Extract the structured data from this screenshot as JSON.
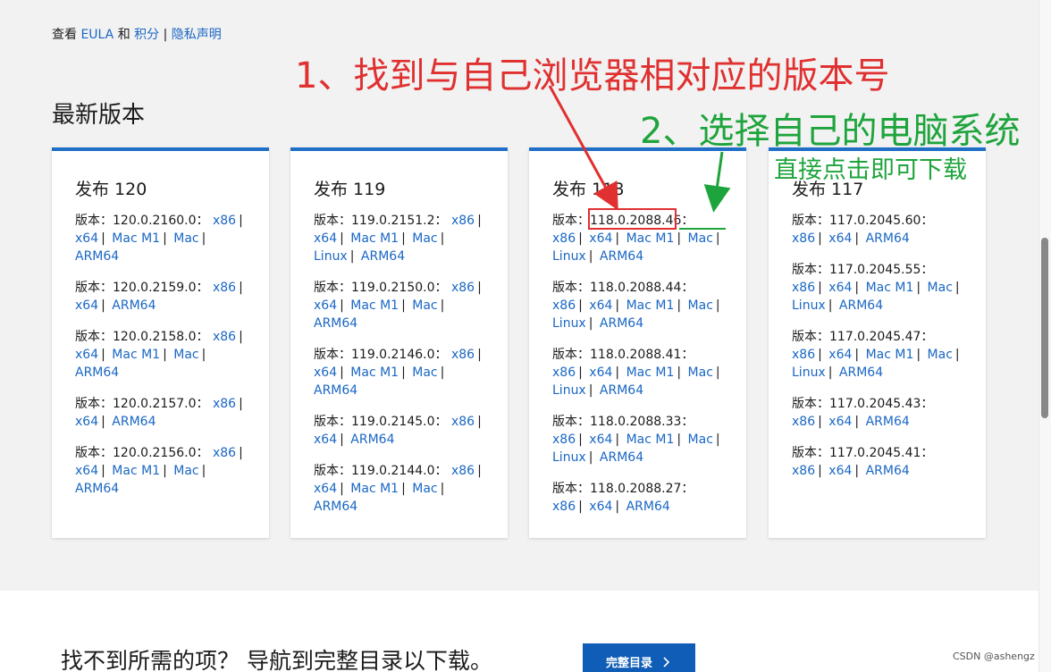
{
  "top_links": {
    "prefix": "查看",
    "eula": "EULA",
    "and": "和",
    "points": "积分",
    "sep": "|",
    "privacy": "隐私声明"
  },
  "section_title": "最新版本",
  "version_prefix": "版本：",
  "separator": "|",
  "cards": [
    {
      "title": "发布 120",
      "versions": [
        {
          "number": "120.0.2160.0：",
          "links": [
            "x86",
            "x64",
            "Mac M1",
            "Mac",
            "ARM64"
          ]
        },
        {
          "number": "120.0.2159.0：",
          "links": [
            "x86",
            "x64",
            "ARM64"
          ]
        },
        {
          "number": "120.0.2158.0：",
          "links": [
            "x86",
            "x64",
            "Mac M1",
            "Mac",
            "ARM64"
          ]
        },
        {
          "number": "120.0.2157.0：",
          "links": [
            "x86",
            "x64",
            "ARM64"
          ]
        },
        {
          "number": "120.0.2156.0：",
          "links": [
            "x86",
            "x64",
            "Mac M1",
            "Mac",
            "ARM64"
          ]
        }
      ]
    },
    {
      "title": "发布 119",
      "versions": [
        {
          "number": "119.0.2151.2：",
          "links": [
            "x86",
            "x64",
            "Mac M1",
            "Mac",
            "Linux",
            "ARM64"
          ]
        },
        {
          "number": "119.0.2150.0：",
          "links": [
            "x86",
            "x64",
            "Mac M1",
            "Mac",
            "ARM64"
          ]
        },
        {
          "number": "119.0.2146.0：",
          "links": [
            "x86",
            "x64",
            "Mac M1",
            "Mac",
            "ARM64"
          ]
        },
        {
          "number": "119.0.2145.0：",
          "links": [
            "x86",
            "x64",
            "ARM64"
          ]
        },
        {
          "number": "119.0.2144.0：",
          "links": [
            "x86",
            "x64",
            "Mac M1",
            "Mac",
            "ARM64"
          ]
        }
      ]
    },
    {
      "title": "发布 118",
      "versions": [
        {
          "number": "118.0.2088.46：",
          "links": [
            "x86",
            "x64",
            "Mac M1",
            "Mac",
            "Linux",
            "ARM64"
          ]
        },
        {
          "number": "118.0.2088.44：",
          "links": [
            "x86",
            "x64",
            "Mac M1",
            "Mac",
            "Linux",
            "ARM64"
          ]
        },
        {
          "number": "118.0.2088.41：",
          "links": [
            "x86",
            "x64",
            "Mac M1",
            "Mac",
            "Linux",
            "ARM64"
          ]
        },
        {
          "number": "118.0.2088.33：",
          "links": [
            "x86",
            "x64",
            "Mac M1",
            "Mac",
            "Linux",
            "ARM64"
          ]
        },
        {
          "number": "118.0.2088.27：",
          "links": [
            "x86",
            "x64",
            "ARM64"
          ]
        }
      ]
    },
    {
      "title": "发布 117",
      "versions": [
        {
          "number": "117.0.2045.60：",
          "links": [
            "x86",
            "x64",
            "ARM64"
          ]
        },
        {
          "number": "117.0.2045.55：",
          "links": [
            "x86",
            "x64",
            "Mac M1",
            "Mac",
            "Linux",
            "ARM64"
          ]
        },
        {
          "number": "117.0.2045.47：",
          "links": [
            "x86",
            "x64",
            "Mac M1",
            "Mac",
            "Linux",
            "ARM64"
          ]
        },
        {
          "number": "117.0.2045.43：",
          "links": [
            "x86",
            "x64",
            "ARM64"
          ]
        },
        {
          "number": "117.0.2045.41：",
          "links": [
            "x86",
            "x64",
            "ARM64"
          ]
        }
      ]
    }
  ],
  "footer": {
    "text": "找不到所需的项？ 导航到完整目录以下载。",
    "button_label": "完整目录",
    "button_icon": "chevron-right-icon"
  },
  "annotations": {
    "step1": "1、找到与自己浏览器相对应的版本号",
    "step2": "2、选择自己的电脑系统",
    "step2_sub": "直接点击即可下载",
    "red_color": "#e03030",
    "green_color": "#1ea43c"
  },
  "watermark": "CSDN @ashengz",
  "colors": {
    "link": "#1a67c4",
    "card_accent": "#1f6fc6",
    "button_bg": "#0f5db6",
    "page_bg": "#f2f2f2"
  }
}
